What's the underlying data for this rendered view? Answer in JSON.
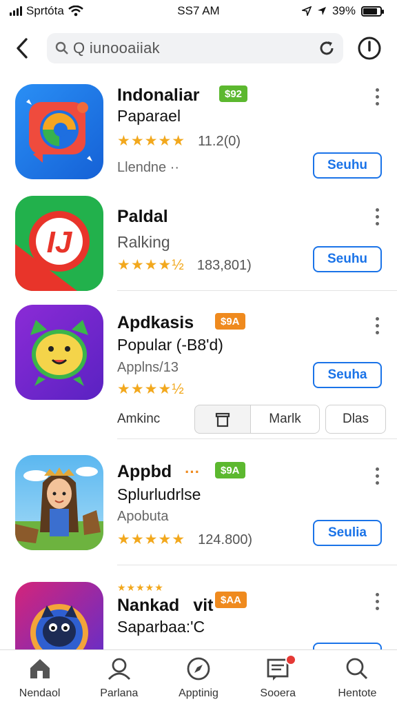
{
  "status_bar": {
    "carrier": "Sprtóta",
    "time": "SS7 AM",
    "battery": "39%",
    "battery_level": 0.85
  },
  "header": {
    "search_text": "Q iunooaiiak"
  },
  "apps": [
    {
      "title": "Indonaliar",
      "subtitle": "Paparael",
      "badge": "$92",
      "badge_color": "#5cb82f",
      "stars": "★★★★★",
      "rating_count": "11.2(0)",
      "meta": "Llendne ··",
      "button": "Seuhu",
      "rating": 5
    },
    {
      "title": "Paldal",
      "subtitle": "Ralking",
      "stars": "★★★★½",
      "rating_count": "183,801)",
      "button": "Seuhu",
      "rating": 4.5
    },
    {
      "title": "Apdkasis",
      "subtitle": "Popular (-B8'd)",
      "badge": "$9A",
      "badge_color": "#ef8a1e",
      "meta": "Applns/13",
      "stars": "★★★★½",
      "button": "Seuha",
      "rating": 4.5
    },
    {
      "title": "Appbd",
      "title_dots": "···",
      "subtitle": "Splurludrlse",
      "badge": "$9A",
      "badge_color": "#5cb82f",
      "meta": "Apobuta",
      "stars": "★★★★★",
      "rating_count": "124.800)",
      "button": "Seulia",
      "rating": 5
    },
    {
      "title": "Nankad",
      "title_suffix": "vit",
      "subtitle": "Saparbaa:'C",
      "badge": "$AA",
      "badge_color": "#ef8a1e",
      "stars": "★★★★★",
      "rating": 5
    }
  ],
  "segment": {
    "label": "Amkinc",
    "option_2": "Marlk",
    "option_3": "Dlas"
  },
  "nav": {
    "items": [
      {
        "label": "Nendaol",
        "icon": "home-icon"
      },
      {
        "label": "Parlana",
        "icon": "profile-icon"
      },
      {
        "label": "Apptinig",
        "icon": "compass-icon"
      },
      {
        "label": "Sooera",
        "icon": "inbox-icon"
      },
      {
        "label": "Hentote",
        "icon": "search-icon"
      }
    ]
  },
  "colors": {
    "accent": "#1a73e8",
    "star": "#f2a81d",
    "badge_green": "#5cb82f",
    "badge_orange": "#ef8a1e",
    "notification": "#e53935"
  }
}
